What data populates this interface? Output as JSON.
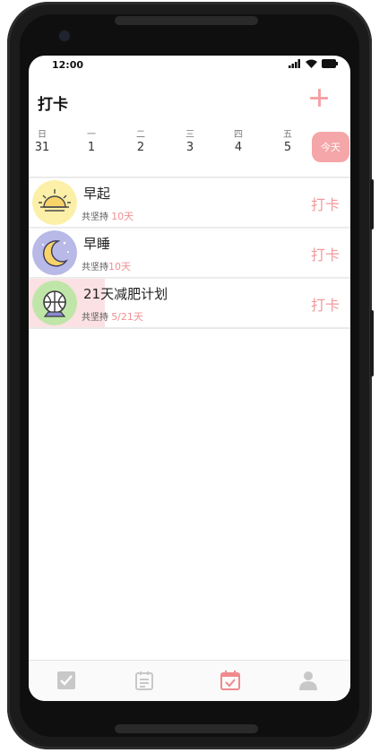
{
  "status": {
    "time": "12:00"
  },
  "header": {
    "title": "打卡"
  },
  "week": [
    {
      "dn": "日",
      "dd": "31"
    },
    {
      "dn": "一",
      "dd": "1"
    },
    {
      "dn": "二",
      "dd": "2"
    },
    {
      "dn": "三",
      "dd": "3"
    },
    {
      "dn": "四",
      "dd": "4"
    },
    {
      "dn": "五",
      "dd": "5"
    }
  ],
  "today_label": "今天",
  "habits": [
    {
      "name": "早起",
      "sub_label": "共坚持",
      "sub_value": "10天",
      "action": "打卡",
      "icon": "sunrise-icon"
    },
    {
      "name": "早睡",
      "sub_label": "共坚持",
      "sub_value": "10天",
      "action": "打卡",
      "icon": "moon-icon"
    },
    {
      "name": "21天减肥计划",
      "sub_label": "共坚持",
      "sub_value": "5/21天",
      "action": "打卡",
      "icon": "basketball-icon",
      "progress": 0.238
    }
  ],
  "tabs": [
    {
      "icon": "checkbox-icon"
    },
    {
      "icon": "list-icon"
    },
    {
      "icon": "calendar-check-icon",
      "active": true
    },
    {
      "icon": "person-icon"
    }
  ],
  "colors": {
    "accent": "#f2999c",
    "today_bg": "#f5a6a8",
    "progress": "#fbe1e3",
    "tab_inactive": "#c8c8c8",
    "tab_active": "#f0898d"
  }
}
